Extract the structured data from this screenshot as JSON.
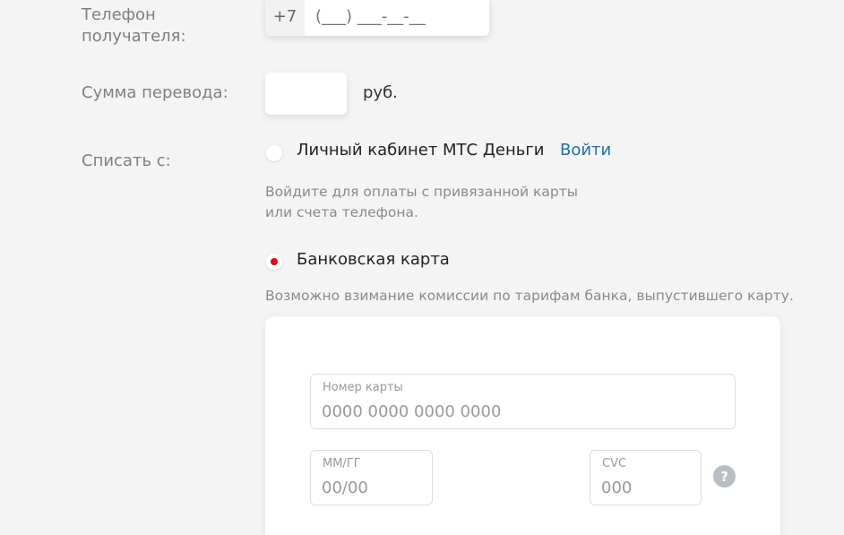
{
  "phone": {
    "label_line1": "Телефон",
    "label_line2": "получателя:",
    "prefix": "+7",
    "placeholder": "(___) ___-__-__"
  },
  "amount": {
    "label": "Сумма перевода:",
    "currency": "руб."
  },
  "debit": {
    "label": "Списать с:",
    "options": [
      {
        "label": "Личный кабинет МТС Деньги",
        "selected": false,
        "link": "Войти",
        "hint_line1": "Войдите для оплаты с привязанной карты",
        "hint_line2": "или счета телефона."
      },
      {
        "label": "Банковская карта",
        "selected": true,
        "hint": "Возможно взимание комиссии по тарифам банка, выпустившего карту."
      }
    ]
  },
  "card": {
    "number_label": "Номер карты",
    "number_placeholder": "0000 0000 0000 0000",
    "expiry_label": "ММ/ГГ",
    "expiry_placeholder": "00/00",
    "cvc_label": "CVC",
    "cvc_placeholder": "000",
    "help_symbol": "?"
  },
  "colors": {
    "accent_red": "#e30611",
    "link_blue": "#1e6ea8"
  }
}
